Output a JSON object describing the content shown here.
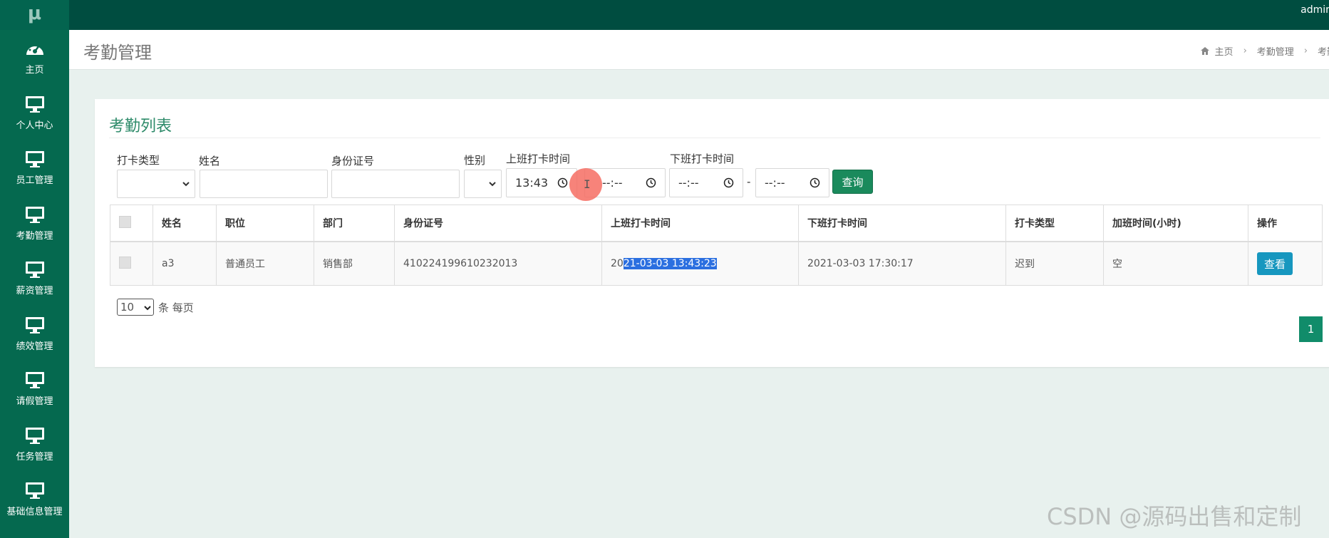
{
  "app": {
    "logo": "μ",
    "user": "admin"
  },
  "sidebar": {
    "items": [
      {
        "label": "主页",
        "icon": "dashboard-icon"
      },
      {
        "label": "个人中心",
        "icon": "monitor-icon"
      },
      {
        "label": "员工管理",
        "icon": "monitor-icon"
      },
      {
        "label": "考勤管理",
        "icon": "monitor-icon"
      },
      {
        "label": "薪资管理",
        "icon": "monitor-icon"
      },
      {
        "label": "绩效管理",
        "icon": "monitor-icon"
      },
      {
        "label": "请假管理",
        "icon": "monitor-icon"
      },
      {
        "label": "任务管理",
        "icon": "monitor-icon"
      },
      {
        "label": "基础信息管理",
        "icon": "monitor-icon"
      }
    ]
  },
  "header": {
    "title": "考勤管理",
    "breadcrumb": [
      "主页",
      "考勤管理",
      "考勤"
    ]
  },
  "panel": {
    "title": "考勤列表"
  },
  "filters": {
    "type_label": "打卡类型",
    "name_label": "姓名",
    "id_label": "身份证号",
    "gender_label": "性别",
    "clock_in_label": "上班打卡时间",
    "clock_out_label": "下班打卡时间",
    "clock_in_from": "13:43",
    "clock_in_to": "--:--",
    "clock_out_from": "--:--",
    "clock_out_to": "--:--",
    "range_dash": "-",
    "search_button": "查询"
  },
  "table": {
    "columns": [
      "姓名",
      "职位",
      "部门",
      "身份证号",
      "上班打卡时间",
      "下班打卡时间",
      "打卡类型",
      "加班时间(小时)",
      "操作"
    ],
    "rows": [
      {
        "name": "a3",
        "position": "普通员工",
        "department": "销售部",
        "id_number": "410224199610232013",
        "clock_in_prefix": "20",
        "clock_in_selected": "21-03-03 13:43:23",
        "clock_out": "2021-03-03 17:30:17",
        "type": "迟到",
        "overtime": "空",
        "action": "查看"
      }
    ]
  },
  "pagination": {
    "per_page": "10",
    "per_page_label": "条 每页",
    "current_page": "1"
  },
  "watermark": "CSDN @源码出售和定制",
  "colors": {
    "topbar": "#004d40",
    "sidebar": "#05694f",
    "accent": "#1a8a5c",
    "view_button": "#1797bf"
  }
}
